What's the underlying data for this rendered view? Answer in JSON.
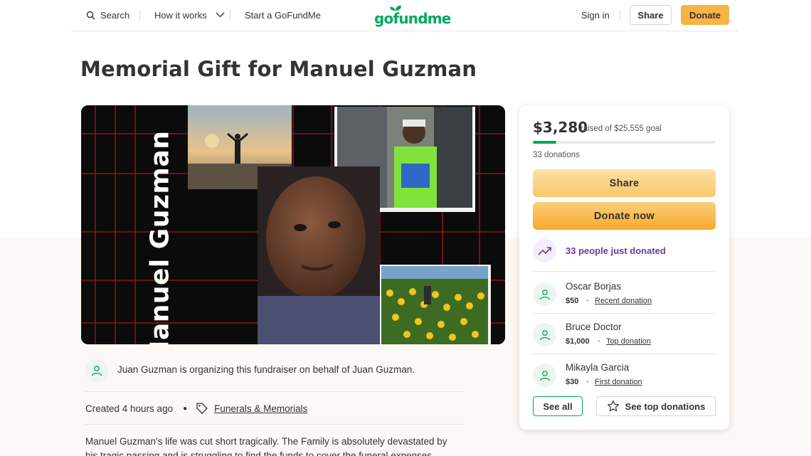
{
  "header": {
    "search_label": "Search",
    "how_it_works_label": "How it works",
    "start_label": "Start a GoFundMe",
    "logo_text": "gofundme",
    "sign_in_label": "Sign in",
    "share_label": "Share",
    "donate_label": "Donate"
  },
  "campaign": {
    "title": "Memorial Gift for Manuel Guzman",
    "hero_name_text": "Manuel Guzman",
    "organizer_text": "Juan Guzman is organizing this fundraiser on behalf of Juan Guzman.",
    "created_text": "Created 4 hours ago",
    "category_label": "Funerals & Memorials",
    "story_excerpt": "Manuel Guzman's life was cut short tragically. The Family is absolutely devastated by his tragic passing and is struggling to find the funds to cover the funeral expenses. Please"
  },
  "donation_card": {
    "raised_amount": "$3,280",
    "goal_text": "raised of $25,555 goal",
    "progress_fraction": 0.128,
    "donation_count_text": "33 donations",
    "share_label": "Share",
    "donate_now_label": "Donate now",
    "recent_activity_text": "33 people just donated",
    "donors": [
      {
        "name": "Oscar Borjas",
        "amount": "$50",
        "label": "Recent donation"
      },
      {
        "name": "Bruce Doctor",
        "amount": "$1,000",
        "label": "Top donation"
      },
      {
        "name": "Mikayla Garcia",
        "amount": "$30",
        "label": "First donation"
      }
    ],
    "see_all_label": "See all",
    "see_top_label": "See top donations"
  },
  "colors": {
    "brand_green": "#02a95c",
    "donate_orange": "#f8b344",
    "activity_purple": "#6a3aa0"
  },
  "icons": [
    "search-icon",
    "chevron-down-icon",
    "tag-icon",
    "trend-up-icon",
    "user-heart-icon",
    "star-icon"
  ]
}
